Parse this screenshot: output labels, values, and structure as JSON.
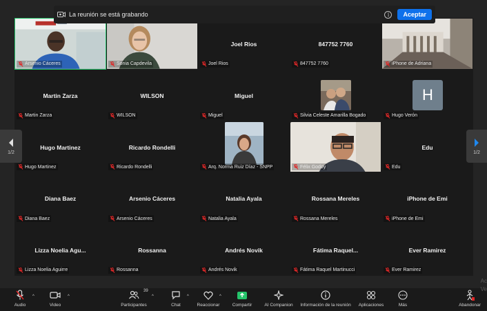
{
  "recording_banner": {
    "text": "La reunión se está grabando",
    "accept_label": "Aceptar"
  },
  "pagination": {
    "left": "1/2",
    "right": "1/2"
  },
  "participants": [
    {
      "name": "Arsenio Cáceres",
      "display": "",
      "video": "person-man",
      "active": true
    },
    {
      "name": "Sonia Capdevila",
      "display": "",
      "video": "person-woman"
    },
    {
      "name": "Joel Rios",
      "display": "Joel Rios"
    },
    {
      "name": "847752 7760",
      "display": "847752 7760"
    },
    {
      "name": "iPhone de Adriana",
      "display": "",
      "video": "room"
    },
    {
      "name": "Martin Zarza",
      "display": "Martin Zarza"
    },
    {
      "name": "WILSON",
      "display": "WILSON"
    },
    {
      "name": "Miguel",
      "display": "Miguel"
    },
    {
      "name": "Silvia Celeste Amarilla Bogado",
      "display": "",
      "video": "photo-couple"
    },
    {
      "name": "Hugo Verón",
      "display": "",
      "avatar_letter": "H"
    },
    {
      "name": "Hugo Martinez",
      "display": "Hugo Martinez"
    },
    {
      "name": "Ricardo Rondelli",
      "display": "Ricardo Rondelli"
    },
    {
      "name": "Arq. Norma Ruiz Díaz - SNPP",
      "display": "",
      "video": "photo-woman"
    },
    {
      "name": "Félix Godoy",
      "display": "",
      "video": "person-man-glasses"
    },
    {
      "name": "Edu",
      "display": "Edu"
    },
    {
      "name": "Diana Baez",
      "display": "Diana Baez"
    },
    {
      "name": "Arsenio Cáceres",
      "display": "Arsenio Cáceres"
    },
    {
      "name": "Natalia Ayala",
      "display": "Natalia Ayala"
    },
    {
      "name": "Rossana Mereles",
      "display": "Rossana Mereles"
    },
    {
      "name": "iPhone de Emi",
      "display": "iPhone de Emi"
    },
    {
      "name": "Lizza Noelia Aguirre",
      "display": "Lizza  Noelia  Agu..."
    },
    {
      "name": "Rossanna",
      "display": "Rossanna"
    },
    {
      "name": "Andrés Novik",
      "display": "Andrés Novik"
    },
    {
      "name": "Fátima Raquel Martinucci",
      "display": "Fátima  Raquel..."
    },
    {
      "name": "Ever Ramirez",
      "display": "Ever Ramirez"
    }
  ],
  "toolbar": {
    "audio": "Audio",
    "video": "Video",
    "participants": "Participantes",
    "participants_count": "39",
    "chat": "Chat",
    "react": "Reaccionar",
    "share": "Compartir",
    "ai": "AI Companion",
    "info": "Información de la reunión",
    "apps": "Aplicaciones",
    "more": "Más",
    "leave": "Abandonar"
  },
  "ghost_text": [
    "Ac",
    "Ve"
  ],
  "colors": {
    "accent": "#0e71eb",
    "share": "#25c36a",
    "mic_off": "#e02828",
    "active_border": "#25c36a"
  }
}
